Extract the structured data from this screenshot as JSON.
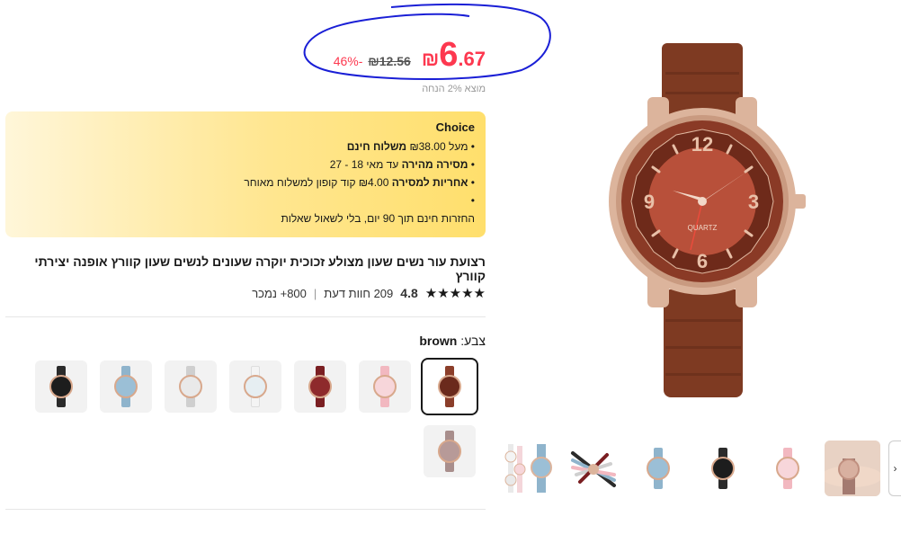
{
  "price": {
    "integer": "6",
    "decimal": ".67",
    "currency_symbol": "₪",
    "original": "₪12.56",
    "discount": "-46%",
    "tax_note": "מוצא 2% הנחה"
  },
  "choice": {
    "title": "Choice",
    "lines": [
      {
        "prefix": "• מעל ₪38.00 ",
        "bold": "משלוח חינם",
        "suffix": ""
      },
      {
        "prefix": "• ",
        "bold": "מסירה מהירה",
        "suffix": " עד מאי 18 - 27"
      },
      {
        "prefix": "• ",
        "bold": "אחריות למסירה",
        "suffix": " ₪4.00 קוד קופון למשלוח מאוחר"
      },
      {
        "prefix": "•",
        "bold": "",
        "suffix": ""
      },
      {
        "prefix": "",
        "bold": "",
        "suffix": "החזרות חינם תוך 90 יום, בלי לשאול שאלות"
      }
    ]
  },
  "product": {
    "title": "רצועת עור נשים שעון מצולע זכוכית יוקרה שעונים לנשים שעון קוורץ אופנה יצירתי קוורץ",
    "rating": "4.8",
    "stars": "★★★★★",
    "reviews": "209 חוות דעת",
    "separator": "|",
    "sold": "800+ נמכר"
  },
  "color": {
    "label": "צבע:",
    "selected": "brown",
    "swatches": [
      {
        "name": "brown",
        "strap": "#8b3e2a",
        "face": "#6b2a1c",
        "selected": true
      },
      {
        "name": "pink",
        "strap": "#f2b8c0",
        "face": "#f7d6da",
        "selected": false
      },
      {
        "name": "burgundy",
        "strap": "#7a1f22",
        "face": "#8e2a2c",
        "selected": false
      },
      {
        "name": "white",
        "strap": "#f4f4f4",
        "face": "#e6eef2",
        "selected": false
      },
      {
        "name": "gray",
        "strap": "#cfcfcf",
        "face": "#e9e9e9",
        "selected": false
      },
      {
        "name": "blue",
        "strap": "#8fb4cc",
        "face": "#9bbfd6",
        "selected": false
      },
      {
        "name": "black",
        "strap": "#2b2b2b",
        "face": "#1d1d1d",
        "selected": false
      },
      {
        "name": "mauve",
        "strap": "#a88e8c",
        "face": "#b79a98",
        "selected": false
      }
    ]
  },
  "main_image": {
    "strap_color": "#7e3a22",
    "case_color": "#dcb49c",
    "dial_color": "#8a3a26",
    "inner_color": "#b8503a",
    "brand": "QUARTZ"
  },
  "gallery": {
    "thumbs": [
      "watch-photo-on-wrist",
      "pink-watch",
      "black-watch",
      "blue-watch",
      "watch-set-fan",
      "watch-set-group"
    ],
    "next_icon": "›"
  },
  "colors": {
    "accent": "#fd384f",
    "annotation": "#1a1fd6"
  }
}
